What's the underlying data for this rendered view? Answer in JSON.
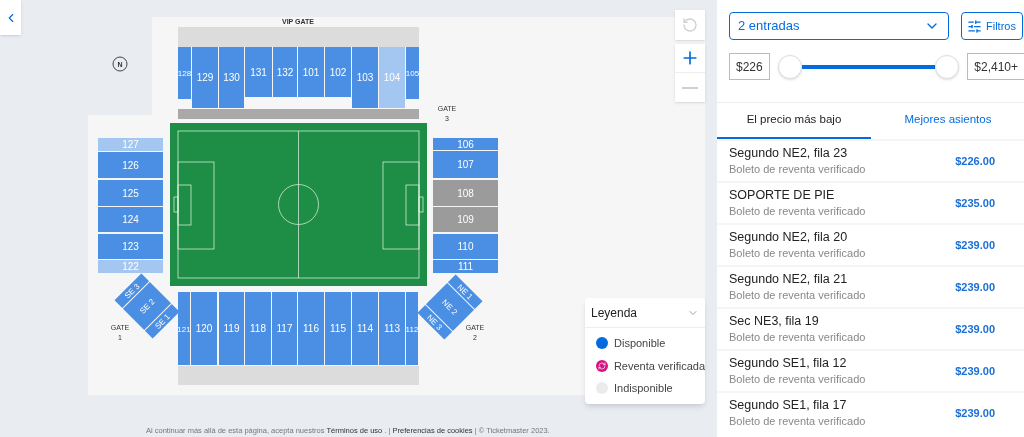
{
  "map": {
    "vip_gate": "VIP GATE",
    "gate_3": [
      "GATE",
      "3"
    ],
    "gate_1": [
      "GATE",
      "1"
    ],
    "gate_2": [
      "GATE",
      "2"
    ],
    "compass": "N",
    "top_sections": [
      {
        "label": "128",
        "color": "#4a8fe3"
      },
      {
        "label": "129",
        "color": "#4a8fe3"
      },
      {
        "label": "130",
        "color": "#4a8fe3"
      },
      {
        "label": "131",
        "color": "#4a8fe3"
      },
      {
        "label": "132",
        "color": "#4a8fe3"
      },
      {
        "label": "101",
        "color": "#4a8fe3"
      },
      {
        "label": "102",
        "color": "#4a8fe3"
      },
      {
        "label": "103",
        "color": "#4a8fe3"
      },
      {
        "label": "104",
        "color": "#a3c7f1"
      },
      {
        "label": "105",
        "color": "#4a8fe3"
      }
    ],
    "left_sections": [
      {
        "label": "127",
        "color": "#a3c7f1"
      },
      {
        "label": "126",
        "color": "#4a8fe3"
      },
      {
        "label": "125",
        "color": "#4a8fe3"
      },
      {
        "label": "124",
        "color": "#4a8fe3"
      },
      {
        "label": "123",
        "color": "#4a8fe3"
      },
      {
        "label": "122",
        "color": "#a3c7f1"
      }
    ],
    "right_sections": [
      {
        "label": "106",
        "color": "#4a8fe3"
      },
      {
        "label": "107",
        "color": "#4a8fe3"
      },
      {
        "label": "108",
        "color": "#9b9b9b"
      },
      {
        "label": "109",
        "color": "#9b9b9b"
      },
      {
        "label": "110",
        "color": "#4a8fe3"
      },
      {
        "label": "111",
        "color": "#4a8fe3"
      }
    ],
    "bottom_sections": [
      {
        "label": "121",
        "color": "#4a8fe3"
      },
      {
        "label": "120",
        "color": "#4a8fe3"
      },
      {
        "label": "119",
        "color": "#4a8fe3"
      },
      {
        "label": "118",
        "color": "#4a8fe3"
      },
      {
        "label": "117",
        "color": "#4a8fe3"
      },
      {
        "label": "116",
        "color": "#4a8fe3"
      },
      {
        "label": "115",
        "color": "#4a8fe3"
      },
      {
        "label": "114",
        "color": "#4a8fe3"
      },
      {
        "label": "113",
        "color": "#4a8fe3"
      },
      {
        "label": "112",
        "color": "#4a8fe3"
      }
    ],
    "southeast_sections": [
      "SE 3",
      "SE 2",
      "SE 1"
    ],
    "northeast_sections": [
      "NE 1",
      "NE 2",
      "NE 3"
    ]
  },
  "controls": {
    "reset_disabled": true,
    "zoom_out_disabled": true
  },
  "legend": {
    "title": "Leyenda",
    "items": [
      {
        "label": "Disponible",
        "kind": "dot",
        "color": "#026cdf"
      },
      {
        "label": "Reventa verificada",
        "kind": "resale",
        "color": "#d6127e"
      },
      {
        "label": "Indisponible",
        "kind": "dot",
        "color": "#ebebeb"
      }
    ]
  },
  "footer": {
    "before": "Al continuar más allá de esta página, acepta nuestros",
    "terms": "Términos de uso",
    "sep": ". |",
    "cookies": "Preferencias de cookies",
    "after": "| © Ticketmaster 2023."
  },
  "quantity": {
    "value": "2 entradas"
  },
  "filters_button": "Filtros",
  "price": {
    "min": "$226",
    "max": "$2,410+"
  },
  "tabs": [
    {
      "label": "El precio más bajo",
      "selected": true
    },
    {
      "label": "Mejores asientos",
      "selected": false
    }
  ],
  "listings": [
    {
      "title": "Segundo NE2, fila 23",
      "subtitle": "Boleto de reventa verificado",
      "price": "$226.00"
    },
    {
      "title": "SOPORTE DE PIE",
      "subtitle": "Boleto de reventa verificado",
      "price": "$235.00"
    },
    {
      "title": "Segundo NE2, fila 20",
      "subtitle": "Boleto de reventa verificado",
      "price": "$239.00"
    },
    {
      "title": "Segundo NE2, fila 21",
      "subtitle": "Boleto de reventa verificado",
      "price": "$239.00"
    },
    {
      "title": "Sec NE3, fila 19",
      "subtitle": "Boleto de reventa verificado",
      "price": "$239.00"
    },
    {
      "title": "Segundo SE1, fila 12",
      "subtitle": "Boleto de reventa verificado",
      "price": "$239.00"
    },
    {
      "title": "Segundo SE1, fila 17",
      "subtitle": "Boleto de reventa verificado",
      "price": "$239.00"
    }
  ]
}
